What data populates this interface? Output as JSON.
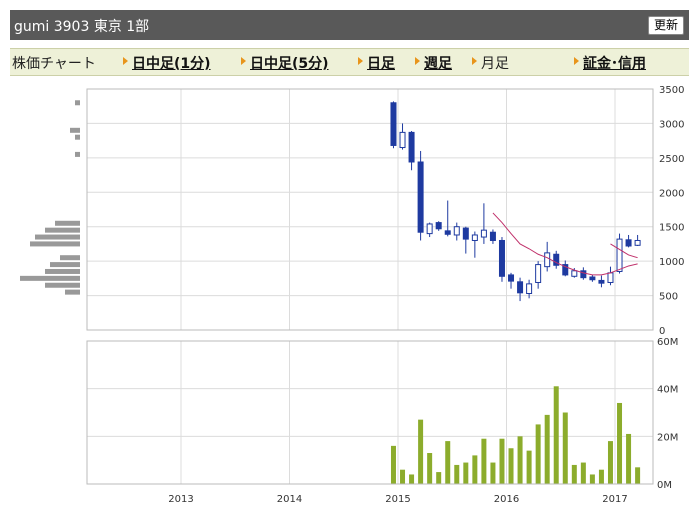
{
  "header": {
    "title": "gumi  3903  東京 1部",
    "refresh_label": "更新"
  },
  "nav": {
    "label": "株価チャート",
    "items": [
      {
        "label": "日中足(1分)",
        "active": false
      },
      {
        "label": "日中足(5分)",
        "active": false
      },
      {
        "label": "日足",
        "active": false
      },
      {
        "label": "週足",
        "active": false
      },
      {
        "label": "月足",
        "active": true
      },
      {
        "label": "証金･信用",
        "active": false
      }
    ]
  },
  "chart_data": {
    "type": "candlestick",
    "x_ticks": [
      "2013",
      "2014",
      "2015",
      "2016",
      "2017"
    ],
    "price_ticks": [
      "3500",
      "3000",
      "2500",
      "2000",
      "1500",
      "1000",
      "500",
      "0"
    ],
    "volume_ticks": [
      "60M",
      "40M",
      "20M",
      "0M"
    ],
    "price_ylim": [
      0,
      3500
    ],
    "volume_ylim": [
      0,
      60000000
    ],
    "grid": true,
    "colors": {
      "up": "#ffffff",
      "down": "#1e3aa0",
      "volume": "#8cac2c",
      "ma": "#c0306a",
      "profile": "#999999",
      "grid": "#dcdcdc"
    },
    "candles": [
      {
        "date": "2014-12",
        "open": 3300,
        "high": 3320,
        "low": 2640,
        "close": 2680
      },
      {
        "date": "2015-01",
        "open": 2650,
        "high": 3000,
        "low": 2620,
        "close": 2870
      },
      {
        "date": "2015-02",
        "open": 2870,
        "high": 2890,
        "low": 2320,
        "close": 2440
      },
      {
        "date": "2015-03",
        "open": 2440,
        "high": 2600,
        "low": 1300,
        "close": 1420
      },
      {
        "date": "2015-04",
        "open": 1400,
        "high": 1560,
        "low": 1350,
        "close": 1540
      },
      {
        "date": "2015-05",
        "open": 1560,
        "high": 1580,
        "low": 1440,
        "close": 1470
      },
      {
        "date": "2015-06",
        "open": 1440,
        "high": 1880,
        "low": 1360,
        "close": 1390
      },
      {
        "date": "2015-07",
        "open": 1380,
        "high": 1560,
        "low": 1300,
        "close": 1500
      },
      {
        "date": "2015-08",
        "open": 1480,
        "high": 1500,
        "low": 1110,
        "close": 1320
      },
      {
        "date": "2015-09",
        "open": 1300,
        "high": 1430,
        "low": 1050,
        "close": 1380
      },
      {
        "date": "2015-10",
        "open": 1350,
        "high": 1840,
        "low": 1250,
        "close": 1450
      },
      {
        "date": "2015-11",
        "open": 1420,
        "high": 1460,
        "low": 1250,
        "close": 1300
      },
      {
        "date": "2015-12",
        "open": 1300,
        "high": 1350,
        "low": 700,
        "close": 780
      },
      {
        "date": "2016-01",
        "open": 800,
        "high": 830,
        "low": 600,
        "close": 710
      },
      {
        "date": "2016-02",
        "open": 700,
        "high": 760,
        "low": 420,
        "close": 540
      },
      {
        "date": "2016-03",
        "open": 530,
        "high": 730,
        "low": 460,
        "close": 670
      },
      {
        "date": "2016-04",
        "open": 690,
        "high": 1000,
        "low": 600,
        "close": 950
      },
      {
        "date": "2016-05",
        "open": 920,
        "high": 1280,
        "low": 850,
        "close": 1120
      },
      {
        "date": "2016-06",
        "open": 1100,
        "high": 1150,
        "low": 890,
        "close": 940
      },
      {
        "date": "2016-07",
        "open": 950,
        "high": 1010,
        "low": 780,
        "close": 800
      },
      {
        "date": "2016-08",
        "open": 780,
        "high": 900,
        "low": 760,
        "close": 860
      },
      {
        "date": "2016-09",
        "open": 860,
        "high": 910,
        "low": 730,
        "close": 760
      },
      {
        "date": "2016-10",
        "open": 770,
        "high": 800,
        "low": 700,
        "close": 730
      },
      {
        "date": "2016-11",
        "open": 720,
        "high": 790,
        "low": 620,
        "close": 680
      },
      {
        "date": "2016-12",
        "open": 690,
        "high": 920,
        "low": 650,
        "close": 830
      },
      {
        "date": "2017-01",
        "open": 850,
        "high": 1400,
        "low": 820,
        "close": 1320
      },
      {
        "date": "2017-02",
        "open": 1310,
        "high": 1380,
        "low": 1200,
        "close": 1220
      },
      {
        "date": "2017-03",
        "open": 1230,
        "high": 1380,
        "low": 1220,
        "close": 1300
      }
    ],
    "ma_lines": [
      {
        "name": "",
        "values": [
          [
            "2015-11",
            1700
          ],
          [
            "2015-12",
            1560
          ],
          [
            "2016-01",
            1400
          ],
          [
            "2016-02",
            1250
          ],
          [
            "2016-03",
            1180
          ],
          [
            "2016-04",
            1100
          ],
          [
            "2016-05",
            1050
          ],
          [
            "2016-06",
            980
          ],
          [
            "2016-07",
            920
          ],
          [
            "2016-08",
            870
          ],
          [
            "2016-09",
            830
          ],
          [
            "2016-10",
            800
          ],
          [
            "2016-11",
            800
          ],
          [
            "2016-12",
            830
          ],
          [
            "2017-01",
            880
          ],
          [
            "2017-02",
            930
          ],
          [
            "2017-03",
            960
          ]
        ]
      },
      {
        "name": "",
        "values": [
          [
            "2016-12",
            1250
          ],
          [
            "2017-01",
            1170
          ],
          [
            "2017-02",
            1090
          ],
          [
            "2017-03",
            1050
          ]
        ]
      }
    ],
    "volume": [
      {
        "date": "2014-12",
        "value": 16000000
      },
      {
        "date": "2015-01",
        "value": 6000000
      },
      {
        "date": "2015-02",
        "value": 4000000
      },
      {
        "date": "2015-03",
        "value": 27000000
      },
      {
        "date": "2015-04",
        "value": 13000000
      },
      {
        "date": "2015-05",
        "value": 5000000
      },
      {
        "date": "2015-06",
        "value": 18000000
      },
      {
        "date": "2015-07",
        "value": 8000000
      },
      {
        "date": "2015-08",
        "value": 9000000
      },
      {
        "date": "2015-09",
        "value": 12000000
      },
      {
        "date": "2015-10",
        "value": 19000000
      },
      {
        "date": "2015-11",
        "value": 9000000
      },
      {
        "date": "2015-12",
        "value": 19000000
      },
      {
        "date": "2016-01",
        "value": 15000000
      },
      {
        "date": "2016-02",
        "value": 20000000
      },
      {
        "date": "2016-03",
        "value": 14000000
      },
      {
        "date": "2016-04",
        "value": 25000000
      },
      {
        "date": "2016-05",
        "value": 29000000
      },
      {
        "date": "2016-06",
        "value": 41000000
      },
      {
        "date": "2016-07",
        "value": 30000000
      },
      {
        "date": "2016-08",
        "value": 8000000
      },
      {
        "date": "2016-09",
        "value": 9000000
      },
      {
        "date": "2016-10",
        "value": 4000000
      },
      {
        "date": "2016-11",
        "value": 6000000
      },
      {
        "date": "2016-12",
        "value": 18000000
      },
      {
        "date": "2017-01",
        "value": 34000000
      },
      {
        "date": "2017-02",
        "value": 21000000
      },
      {
        "date": "2017-03",
        "value": 7000000
      }
    ],
    "price_volume_profile": [
      {
        "price": 3300,
        "volume": 1
      },
      {
        "price": 2900,
        "volume": 2
      },
      {
        "price": 2800,
        "volume": 1
      },
      {
        "price": 2550,
        "volume": 1
      },
      {
        "price": 1550,
        "volume": 5
      },
      {
        "price": 1450,
        "volume": 7
      },
      {
        "price": 1350,
        "volume": 9
      },
      {
        "price": 1250,
        "volume": 10
      },
      {
        "price": 1050,
        "volume": 4
      },
      {
        "price": 950,
        "volume": 6
      },
      {
        "price": 850,
        "volume": 7
      },
      {
        "price": 750,
        "volume": 12
      },
      {
        "price": 650,
        "volume": 7
      },
      {
        "price": 550,
        "volume": 3
      }
    ]
  }
}
